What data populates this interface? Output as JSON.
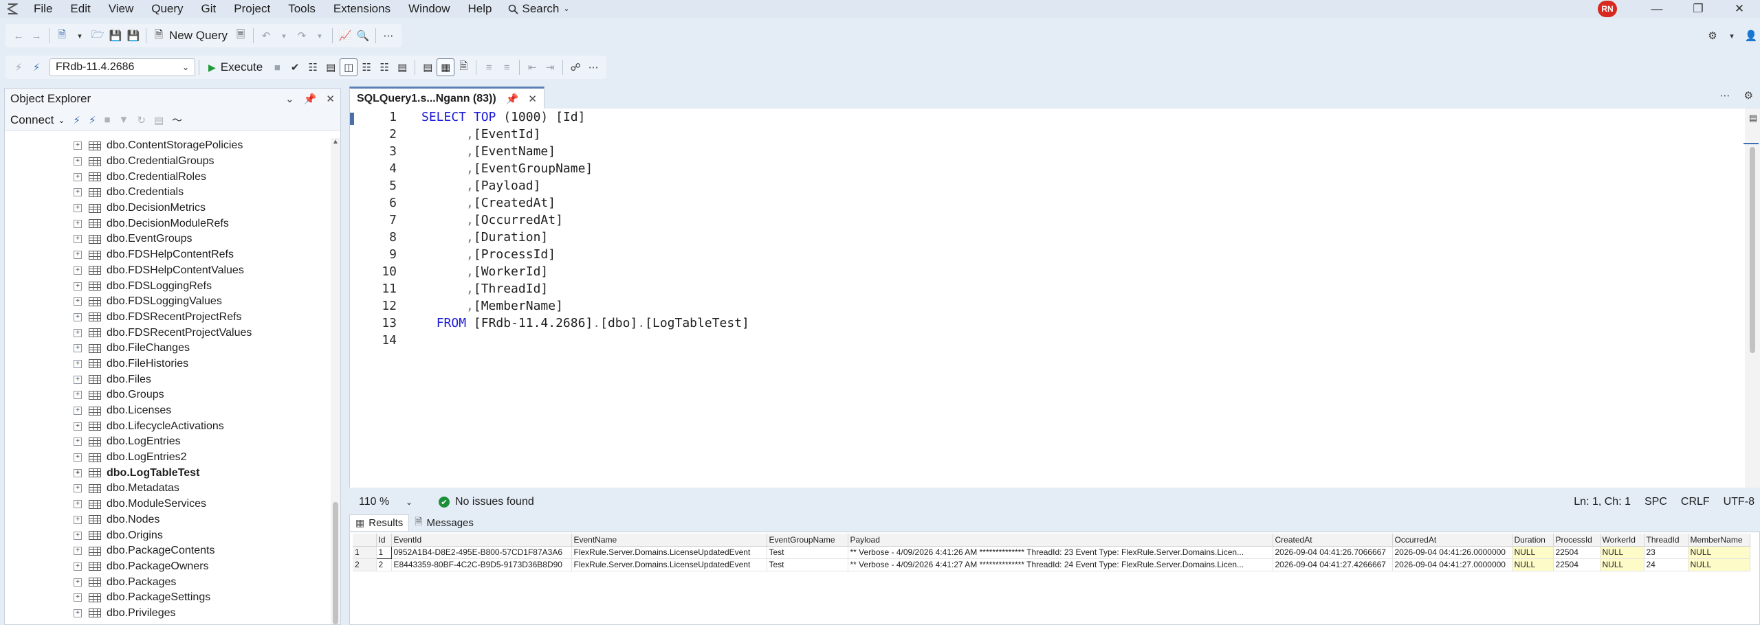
{
  "menubar": {
    "items": [
      "File",
      "Edit",
      "View",
      "Query",
      "Git",
      "Project",
      "Tools",
      "Extensions",
      "Window",
      "Help"
    ],
    "search_label": "Search",
    "avatar_initials": "RN"
  },
  "toolbar": {
    "new_query_label": "New Query",
    "database": "FRdb-11.4.2686",
    "execute_label": "Execute"
  },
  "object_explorer": {
    "title": "Object Explorer",
    "connect_label": "Connect",
    "items": [
      "dbo.ContentStoragePolicies",
      "dbo.CredentialGroups",
      "dbo.CredentialRoles",
      "dbo.Credentials",
      "dbo.DecisionMetrics",
      "dbo.DecisionModuleRefs",
      "dbo.EventGroups",
      "dbo.FDSHelpContentRefs",
      "dbo.FDSHelpContentValues",
      "dbo.FDSLoggingRefs",
      "dbo.FDSLoggingValues",
      "dbo.FDSRecentProjectRefs",
      "dbo.FDSRecentProjectValues",
      "dbo.FileChanges",
      "dbo.FileHistories",
      "dbo.Files",
      "dbo.Groups",
      "dbo.Licenses",
      "dbo.LifecycleActivations",
      "dbo.LogEntries",
      "dbo.LogEntries2",
      "dbo.LogTableTest",
      "dbo.Metadatas",
      "dbo.ModuleServices",
      "dbo.Nodes",
      "dbo.Origins",
      "dbo.PackageContents",
      "dbo.PackageOwners",
      "dbo.Packages",
      "dbo.PackageSettings",
      "dbo.Privileges"
    ],
    "selected_item": "dbo.LogTableTest"
  },
  "document_tab": {
    "title": "SQLQuery1.s...Ngann (83))"
  },
  "editor": {
    "line_numbers": [
      "1",
      "2",
      "3",
      "4",
      "5",
      "6",
      "7",
      "8",
      "9",
      "10",
      "11",
      "12",
      "13",
      "14"
    ],
    "select_kw": "SELECT",
    "top_kw": "TOP",
    "top_value": "(1000)",
    "first_column": "[Id]",
    "columns": [
      "[EventId]",
      "[EventName]",
      "[EventGroupName]",
      "[Payload]",
      "[CreatedAt]",
      "[OccurredAt]",
      "[Duration]",
      "[ProcessId]",
      "[WorkerId]",
      "[ThreadId]",
      "[MemberName]"
    ],
    "from_kw": "FROM",
    "from_db": "[FRdb-11.4.2686]",
    "from_schema": "[dbo]",
    "from_table": "[LogTableTest]",
    "dot": ".",
    "comma": ","
  },
  "status": {
    "zoom": "110 %",
    "issues": "No issues found",
    "position": "Ln: 1, Ch: 1",
    "spc": "SPC",
    "line_ending": "CRLF",
    "encoding": "UTF-8"
  },
  "results": {
    "tabs": [
      "Results",
      "Messages"
    ],
    "columns": [
      "",
      "Id",
      "EventId",
      "EventName",
      "EventGroupName",
      "Payload",
      "CreatedAt",
      "OccurredAt",
      "Duration",
      "ProcessId",
      "WorkerId",
      "ThreadId",
      "MemberName"
    ],
    "rows": [
      [
        "1",
        "1",
        "0952A1B4-D8E2-495E-B800-57CD1F87A3A6",
        "FlexRule.Server.Domains.LicenseUpdatedEvent",
        "Test",
        "** Verbose - 4/09/2026 4:41:26 AM ************** ThreadId: 23  Event Type: FlexRule.Server.Domains.Licen...",
        "2026-09-04 04:41:26.7066667",
        "2026-09-04 04:41:26.0000000",
        "NULL",
        "22504",
        "NULL",
        "23",
        "NULL"
      ],
      [
        "2",
        "2",
        "E8443359-80BF-4C2C-B9D5-9173D36B8D90",
        "FlexRule.Server.Domains.LicenseUpdatedEvent",
        "Test",
        "** Verbose - 4/09/2026 4:41:27 AM ************** ThreadId: 24  Event Type: FlexRule.Server.Domains.Licen...",
        "2026-09-04 04:41:27.4266667",
        "2026-09-04 04:41:27.0000000",
        "NULL",
        "22504",
        "NULL",
        "24",
        "NULL"
      ]
    ]
  },
  "colors": {
    "keyword": "#1b1bd8",
    "accent": "#3c6fb0",
    "null_cell": "#fdfbc8",
    "ok_green": "#1d8f3a",
    "avatar": "#d8281f"
  }
}
